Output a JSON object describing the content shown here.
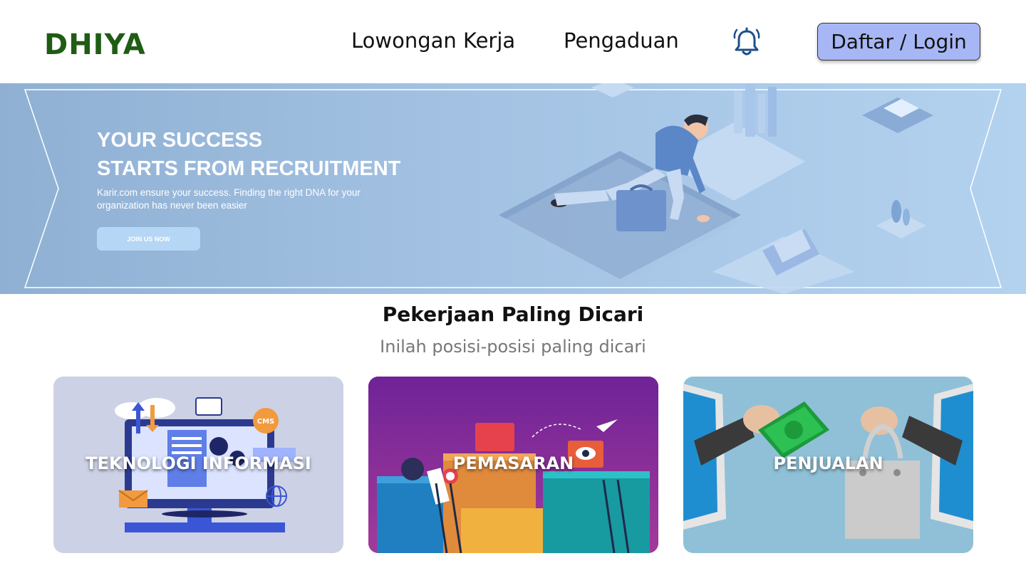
{
  "header": {
    "logo": "DHIYA",
    "nav": [
      {
        "label": "Lowongan Kerja"
      },
      {
        "label": "Pengaduan"
      }
    ],
    "notification_icon": "bell-icon",
    "login_label": "Daftar / Login"
  },
  "hero": {
    "title_line1": "YOUR SUCCESS",
    "title_line2": "STARTS FROM RECRUITMENT",
    "description": "Karir.com ensure your success. Finding the right DNA for your organization has never been easier",
    "cta_label": "JOIN US NOW"
  },
  "section": {
    "title": "Pekerjaan Paling Dicari",
    "subtitle": "Inilah posisi-posisi paling dicari"
  },
  "categories": [
    {
      "label": "TEKNOLOGI INFORMASI"
    },
    {
      "label": "PEMASARAN"
    },
    {
      "label": "PENJUALAN"
    }
  ],
  "colors": {
    "brand": "#1f5c14",
    "login_button": "#a7b6f4",
    "hero_background": "#a3c2e3",
    "card_it": "#cdd1e6",
    "card_marketing": "#6f2397",
    "card_sales": "#8fc0d7"
  }
}
